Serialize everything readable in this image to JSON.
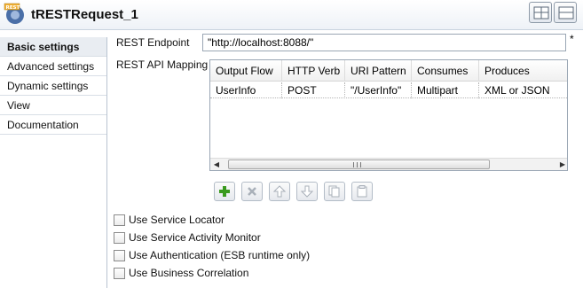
{
  "window": {
    "title": "tRESTRequest_1",
    "app_icon": "rest-logo-icon"
  },
  "sidebar": {
    "items": [
      {
        "label": "Basic settings",
        "active": true
      },
      {
        "label": "Advanced settings",
        "active": false
      },
      {
        "label": "Dynamic settings",
        "active": false
      },
      {
        "label": "View",
        "active": false
      },
      {
        "label": "Documentation",
        "active": false
      }
    ]
  },
  "main": {
    "endpoint_label": "REST Endpoint",
    "endpoint_value": "\"http://localhost:8088/\"",
    "required_marker": "*",
    "mapping_label": "REST API Mapping",
    "mapping_table": {
      "columns": [
        "Output Flow",
        "HTTP Verb",
        "URI Pattern",
        "Consumes",
        "Produces"
      ],
      "rows": [
        [
          "UserInfo",
          "POST",
          "\"/UserInfo\"",
          "Multipart",
          "XML or JSON"
        ]
      ]
    },
    "table_toolbar": [
      "add-icon",
      "remove-icon",
      "move-up-icon",
      "move-down-icon",
      "copy-icon",
      "paste-icon"
    ],
    "checkboxes": [
      {
        "label": "Use Service Locator",
        "checked": false
      },
      {
        "label": "Use Service Activity Monitor",
        "checked": false
      },
      {
        "label": "Use Authentication (ESB runtime only)",
        "checked": false
      },
      {
        "label": "Use Business Correlation",
        "checked": false
      }
    ]
  },
  "colors": {
    "accent_green": "#3a9a1e",
    "border": "#9aa6b4",
    "sidebar_active": "#e9edf2"
  }
}
